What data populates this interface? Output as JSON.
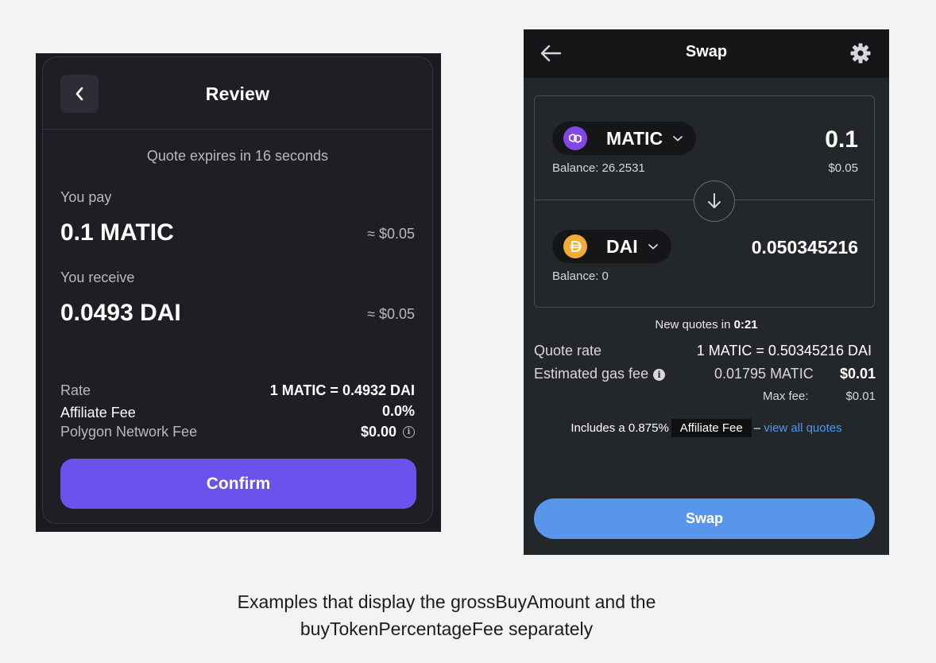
{
  "review": {
    "title": "Review",
    "quote_expires": "Quote expires in 16 seconds",
    "you_pay_label": "You pay",
    "you_pay_amount": "0.1 MATIC",
    "you_pay_usd": "≈ $0.05",
    "you_receive_label": "You receive",
    "you_receive_amount": "0.0493 DAI",
    "you_receive_usd": "≈ $0.05",
    "rate_label": "Rate",
    "rate_value": "1 MATIC = 0.4932 DAI",
    "affiliate_label": "Affiliate Fee",
    "affiliate_value": "0.0%",
    "network_label": "Polygon Network Fee",
    "network_value": "$0.00",
    "confirm_label": "Confirm",
    "colors": {
      "accent": "#6b52ec",
      "card": "#1e1f25"
    }
  },
  "swap": {
    "title": "Swap",
    "from": {
      "token": "MATIC",
      "balance": "Balance: 26.2531",
      "amount": "0.1",
      "usd": "$0.05"
    },
    "to": {
      "token": "DAI",
      "balance": "Balance: 0",
      "amount": "0.050345216"
    },
    "new_quotes_prefix": "New quotes in",
    "new_quotes_time": "0:21",
    "quote_rate_label": "Quote rate",
    "quote_rate_value": "1 MATIC = 0.50345216 DAI",
    "gas_label": "Estimated gas fee",
    "gas_value": "0.01795 MATIC",
    "gas_usd": "$0.01",
    "max_fee_label": "Max fee:",
    "max_fee_value": "$0.01",
    "includes_prefix": "Includes a 0.875%",
    "affiliate_chip": "Affiliate Fee",
    "dash": "–",
    "view_quotes": "view all quotes",
    "swap_label": "Swap",
    "colors": {
      "button": "#5896ec",
      "link": "#4f95ee",
      "matic": "#8247e5",
      "dai": "#f5ac37"
    }
  },
  "caption": {
    "line1": "Examples that display the grossBuyAmount and the",
    "line2": "buyTokenPercentageFee separately"
  }
}
